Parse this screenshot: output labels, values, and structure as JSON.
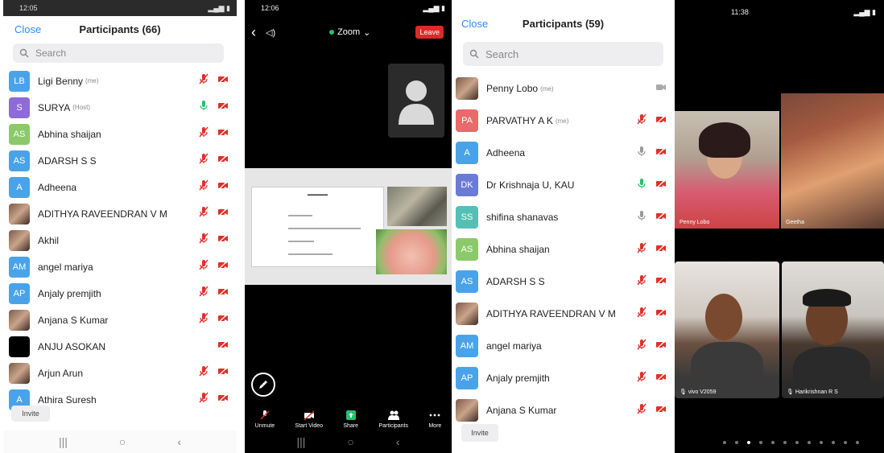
{
  "panel1": {
    "status_time": "12:05",
    "close_label": "Close",
    "title": "Participants (66)",
    "search_placeholder": "Search",
    "invite_label": "Invite",
    "participants": [
      {
        "initials": "LB",
        "name": "Ligi Benny",
        "tag": "(me)",
        "color": "#4aa3e8",
        "mic": "muted"
      },
      {
        "initials": "S",
        "name": "SURYA",
        "tag": "(Host)",
        "color": "#8e6bd6",
        "mic": "on"
      },
      {
        "initials": "AS",
        "name": "Abhina shaijan",
        "tag": "",
        "color": "#8bc96a",
        "mic": "muted"
      },
      {
        "initials": "AS",
        "name": "ADARSH S S",
        "tag": "",
        "color": "#4aa3e8",
        "mic": "muted"
      },
      {
        "initials": "A",
        "name": "Adheena",
        "tag": "",
        "color": "#4aa3e8",
        "mic": "muted"
      },
      {
        "initials": "",
        "name": "ADITHYA RAVEENDRAN V M",
        "tag": "",
        "color": "photo",
        "mic": "muted"
      },
      {
        "initials": "",
        "name": "Akhil",
        "tag": "",
        "color": "photo",
        "mic": "muted"
      },
      {
        "initials": "AM",
        "name": "angel mariya",
        "tag": "",
        "color": "#4aa3e8",
        "mic": "muted"
      },
      {
        "initials": "AP",
        "name": "Anjaly premjith",
        "tag": "",
        "color": "#4aa3e8",
        "mic": "muted"
      },
      {
        "initials": "",
        "name": "Anjana S Kumar",
        "tag": "",
        "color": "photo",
        "mic": "muted"
      },
      {
        "initials": "",
        "name": "ANJU ASOKAN",
        "tag": "",
        "color": "black",
        "mic": "none"
      },
      {
        "initials": "",
        "name": "Arjun Arun",
        "tag": "",
        "color": "photo",
        "mic": "muted"
      },
      {
        "initials": "A",
        "name": "Athira Suresh",
        "tag": "",
        "color": "#4aa3e8",
        "mic": "muted"
      }
    ]
  },
  "panel2": {
    "status_time": "12:06",
    "meeting_title": "Zoom",
    "leave_label": "Leave",
    "toolbar": [
      {
        "label": "Unmute",
        "icon": "mic-muted-icon"
      },
      {
        "label": "Start Video",
        "icon": "video-off-icon"
      },
      {
        "label": "Share",
        "icon": "share-icon"
      },
      {
        "label": "Participants",
        "icon": "participants-icon"
      },
      {
        "label": "More",
        "icon": "more-icon"
      }
    ]
  },
  "panel3": {
    "close_label": "Close",
    "title": "Participants (59)",
    "search_placeholder": "Search",
    "invite_label": "Invite",
    "participants": [
      {
        "initials": "",
        "name": "Penny Lobo",
        "tag": "(me)",
        "color": "photo",
        "mic": "none"
      },
      {
        "initials": "PA",
        "name": "PARVATHY A K",
        "tag": "(me)",
        "color": "#e86a6a",
        "mic": "muted"
      },
      {
        "initials": "A",
        "name": "Adheena",
        "tag": "",
        "color": "#4aa3e8",
        "mic": "grey"
      },
      {
        "initials": "DK",
        "name": "Dr Krishnaja U, KAU",
        "tag": "",
        "color": "#6a7bd6",
        "mic": "on"
      },
      {
        "initials": "SS",
        "name": "shifina shanavas",
        "tag": "",
        "color": "#52c1b3",
        "mic": "grey"
      },
      {
        "initials": "AS",
        "name": "Abhina shaijan",
        "tag": "",
        "color": "#8bc96a",
        "mic": "muted"
      },
      {
        "initials": "AS",
        "name": "ADARSH S S",
        "tag": "",
        "color": "#4aa3e8",
        "mic": "muted"
      },
      {
        "initials": "",
        "name": "ADITHYA RAVEENDRAN V M",
        "tag": "",
        "color": "photo",
        "mic": "muted"
      },
      {
        "initials": "AM",
        "name": "angel mariya",
        "tag": "",
        "color": "#4aa3e8",
        "mic": "muted"
      },
      {
        "initials": "AP",
        "name": "Anjaly premjith",
        "tag": "",
        "color": "#4aa3e8",
        "mic": "muted"
      },
      {
        "initials": "",
        "name": "Anjana S Kumar",
        "tag": "",
        "color": "photo",
        "mic": "muted"
      }
    ]
  },
  "panel4": {
    "status_time": "11:38",
    "tiles": [
      {
        "name": "Penny Lobo"
      },
      {
        "name": "Geetha"
      },
      {
        "name": "vivo V2059"
      },
      {
        "name": "Harikrishnan R S"
      }
    ]
  },
  "colors": {
    "accent": "#2d8cff",
    "muted_red": "#e0302a",
    "mic_green": "#25c16f"
  }
}
